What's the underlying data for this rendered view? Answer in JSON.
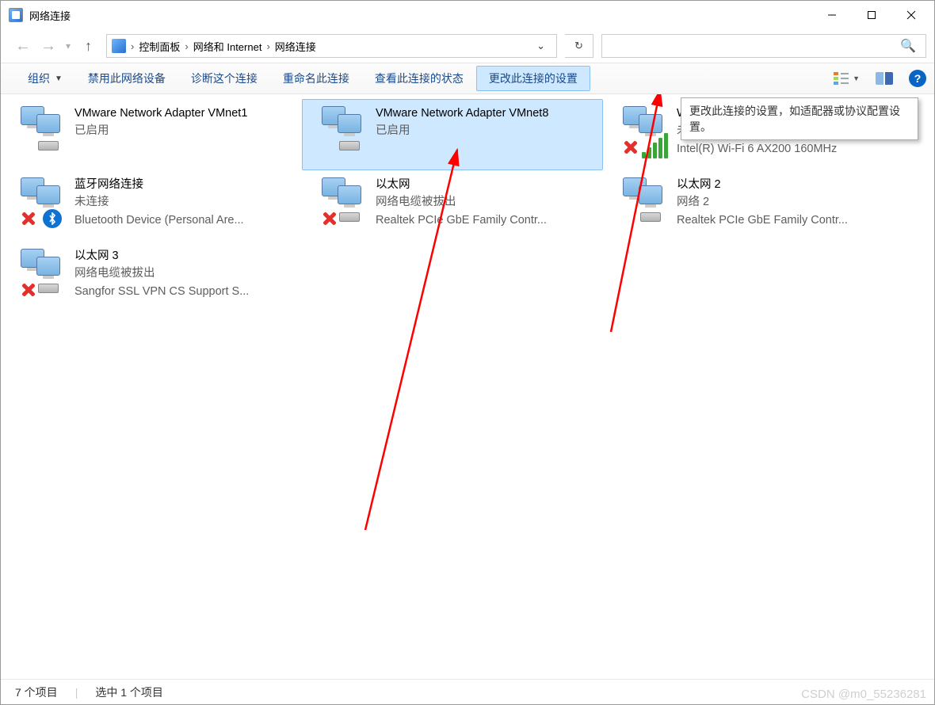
{
  "window": {
    "title": "网络连接"
  },
  "nav": {
    "breadcrumb": [
      "控制面板",
      "网络和 Internet",
      "网络连接"
    ],
    "search_placeholder": ""
  },
  "toolbar": {
    "organize": "组织",
    "disable": "禁用此网络设备",
    "diagnose": "诊断这个连接",
    "rename": "重命名此连接",
    "status": "查看此连接的状态",
    "change": "更改此连接的设置"
  },
  "tooltip": {
    "text": "更改此连接的设置，如适配器或协议配置设置。"
  },
  "items": [
    {
      "name": "VMware Network Adapter VMnet1",
      "status": "已启用",
      "detail": "",
      "icon": "net",
      "overlay": "plug",
      "selected": false
    },
    {
      "name": "VMware Network Adapter VMnet8",
      "status": "已启用",
      "detail": "",
      "icon": "net",
      "overlay": "plug",
      "selected": true
    },
    {
      "name": "WLAN",
      "status": "未连接",
      "detail": "Intel(R) Wi-Fi 6 AX200 160MHz",
      "icon": "net",
      "overlay": "wifi-x",
      "selected": false
    },
    {
      "name": "蓝牙网络连接",
      "status": "未连接",
      "detail": "Bluetooth Device (Personal Are...",
      "icon": "net",
      "overlay": "bt-x",
      "selected": false
    },
    {
      "name": "以太网",
      "status": "网络电缆被拔出",
      "detail": "Realtek PCIe GbE Family Contr...",
      "icon": "net",
      "overlay": "plug-x",
      "selected": false
    },
    {
      "name": "以太网 2",
      "status": "网络 2",
      "detail": "Realtek PCIe GbE Family Contr...",
      "icon": "net",
      "overlay": "plug",
      "selected": false
    },
    {
      "name": "以太网 3",
      "status": "网络电缆被拔出",
      "detail": "Sangfor SSL VPN CS Support S...",
      "icon": "net",
      "overlay": "plug-x",
      "selected": false
    }
  ],
  "statusbar": {
    "items": "7 个项目",
    "selected": "选中 1 个项目"
  },
  "watermark": "CSDN @m0_55236281"
}
